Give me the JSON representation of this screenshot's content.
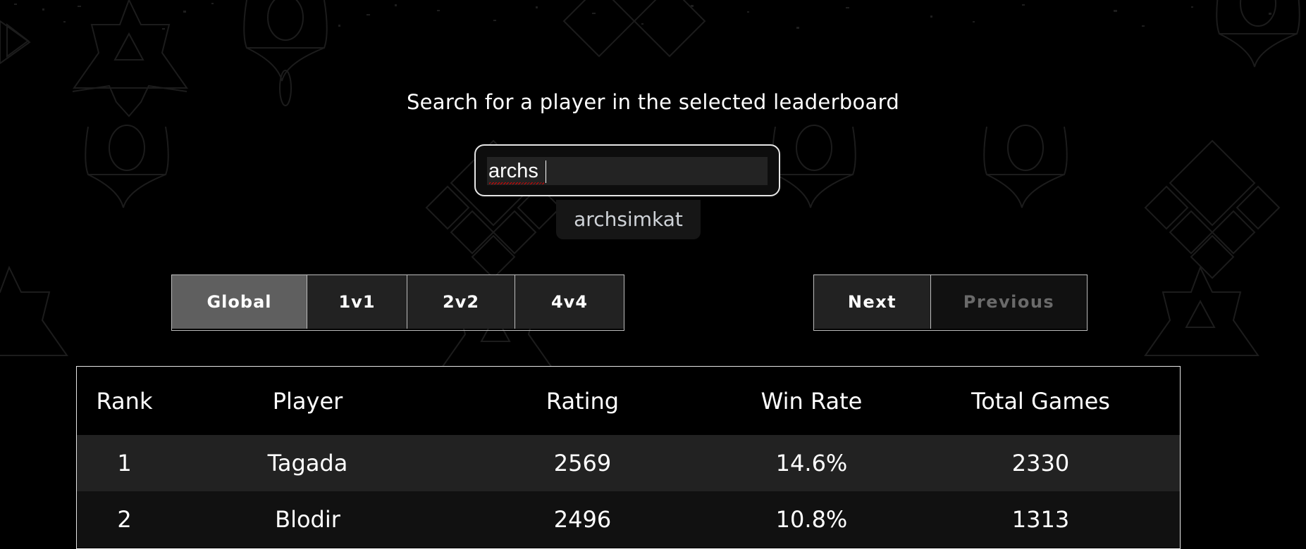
{
  "search": {
    "title": "Search for a player in the selected leaderboard",
    "input_value": "archs",
    "suggestions": [
      "archsimkat"
    ]
  },
  "tabs": [
    {
      "label": "Global",
      "active": true
    },
    {
      "label": "1v1",
      "active": false
    },
    {
      "label": "2v2",
      "active": false
    },
    {
      "label": "4v4",
      "active": false
    }
  ],
  "pagination": {
    "next_label": "Next",
    "previous_label": "Previous",
    "previous_disabled": true
  },
  "table": {
    "headers": [
      "Rank",
      "Player",
      "Rating",
      "Win Rate",
      "Total Games"
    ],
    "rows": [
      {
        "rank": "1",
        "player": "Tagada",
        "rating": "2569",
        "win_rate": "14.6%",
        "total_games": "2330"
      },
      {
        "rank": "2",
        "player": "Blodir",
        "rating": "2496",
        "win_rate": "10.8%",
        "total_games": "1313"
      }
    ]
  },
  "colors": {
    "background": "#000000",
    "tab_active": "#5f5f5f",
    "tab_inactive": "#222222",
    "row_odd": "#222222",
    "row_even": "#111111",
    "disabled_text": "#6a6a6a"
  }
}
